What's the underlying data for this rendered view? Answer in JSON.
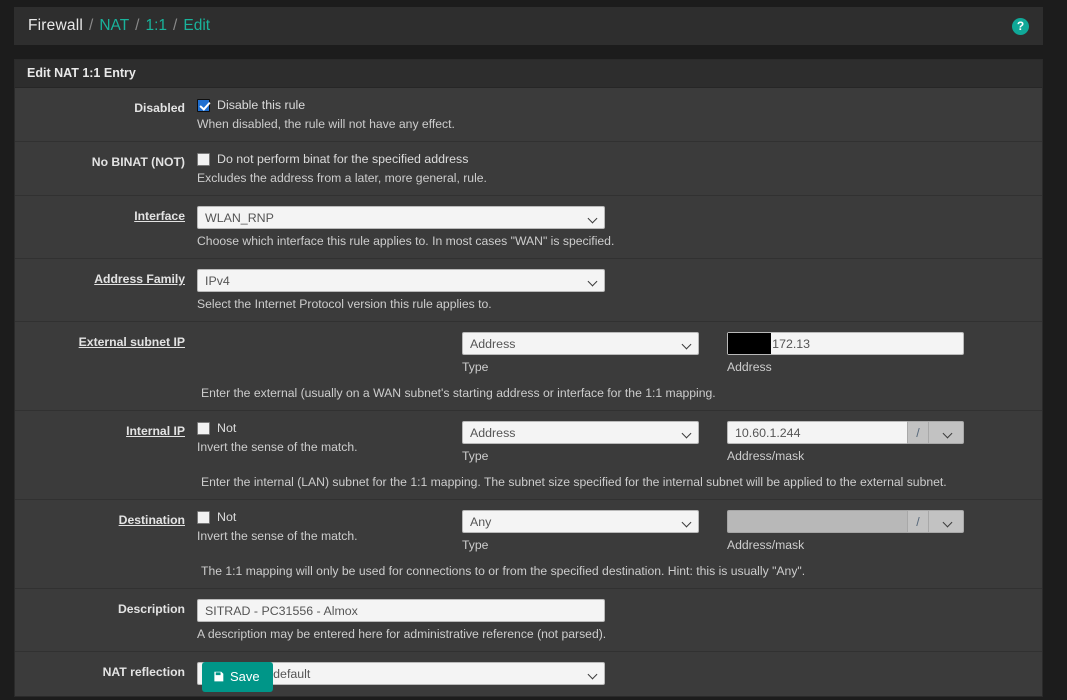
{
  "breadcrumb": {
    "root": "Firewall",
    "sep": "/",
    "links": [
      "NAT",
      "1:1",
      "Edit"
    ],
    "help_icon": "?"
  },
  "panel": {
    "title": "Edit NAT 1:1 Entry"
  },
  "rows": {
    "disabled": {
      "label": "Disabled",
      "checkbox_label": "Disable this rule",
      "checked": true,
      "help": "When disabled, the rule will not have any effect."
    },
    "no_binat": {
      "label": "No BINAT (NOT)",
      "checkbox_label": "Do not perform binat for the specified address",
      "checked": false,
      "help": "Excludes the address from a later, more general, rule."
    },
    "interface": {
      "label": "Interface",
      "value": "WLAN_RNP",
      "help": "Choose which interface this rule applies to. In most cases \"WAN\" is specified."
    },
    "address_family": {
      "label": "Address Family",
      "value": "IPv4",
      "help": "Select the Internet Protocol version this rule applies to."
    },
    "external_subnet": {
      "label": "External subnet IP",
      "type_value": "Address",
      "type_caption": "Type",
      "address_value": "172.13",
      "address_redacted": true,
      "address_caption": "Address",
      "help": "Enter the external (usually on a WAN subnet's starting address or interface for the 1:1 mapping."
    },
    "internal_ip": {
      "label": "Internal IP",
      "not_label": "Not",
      "not_checked": false,
      "not_help": "Invert the sense of the match.",
      "type_value": "Address",
      "type_caption": "Type",
      "address_value": "10.60.1.244",
      "mask_slash": "/",
      "mask_value": "",
      "address_caption": "Address/mask",
      "help": "Enter the internal (LAN) subnet for the 1:1 mapping. The subnet size specified for the internal subnet will be applied to the external subnet."
    },
    "destination": {
      "label": "Destination",
      "not_label": "Not",
      "not_checked": false,
      "not_help": "Invert the sense of the match.",
      "type_value": "Any",
      "type_caption": "Type",
      "address_value": "",
      "address_disabled": true,
      "mask_slash": "/",
      "mask_value": "",
      "address_caption": "Address/mask",
      "help": "The 1:1 mapping will only be used for connections to or from the specified destination. Hint: this is usually \"Any\"."
    },
    "description": {
      "label": "Description",
      "value": "SITRAD - PC31556 - Almox",
      "help": "A description may be entered here for administrative reference (not parsed)."
    },
    "nat_reflection": {
      "label": "NAT reflection",
      "value": "Use system default"
    }
  },
  "actions": {
    "save_label": "Save"
  },
  "colors": {
    "accent": "#19b39b",
    "save_bg": "#009688",
    "checkbox_on": "#1f6fd0",
    "page_bg": "#1c1c1c",
    "panel_bg": "#3b3b3b",
    "panel_head_bg": "#2d2d2d"
  }
}
